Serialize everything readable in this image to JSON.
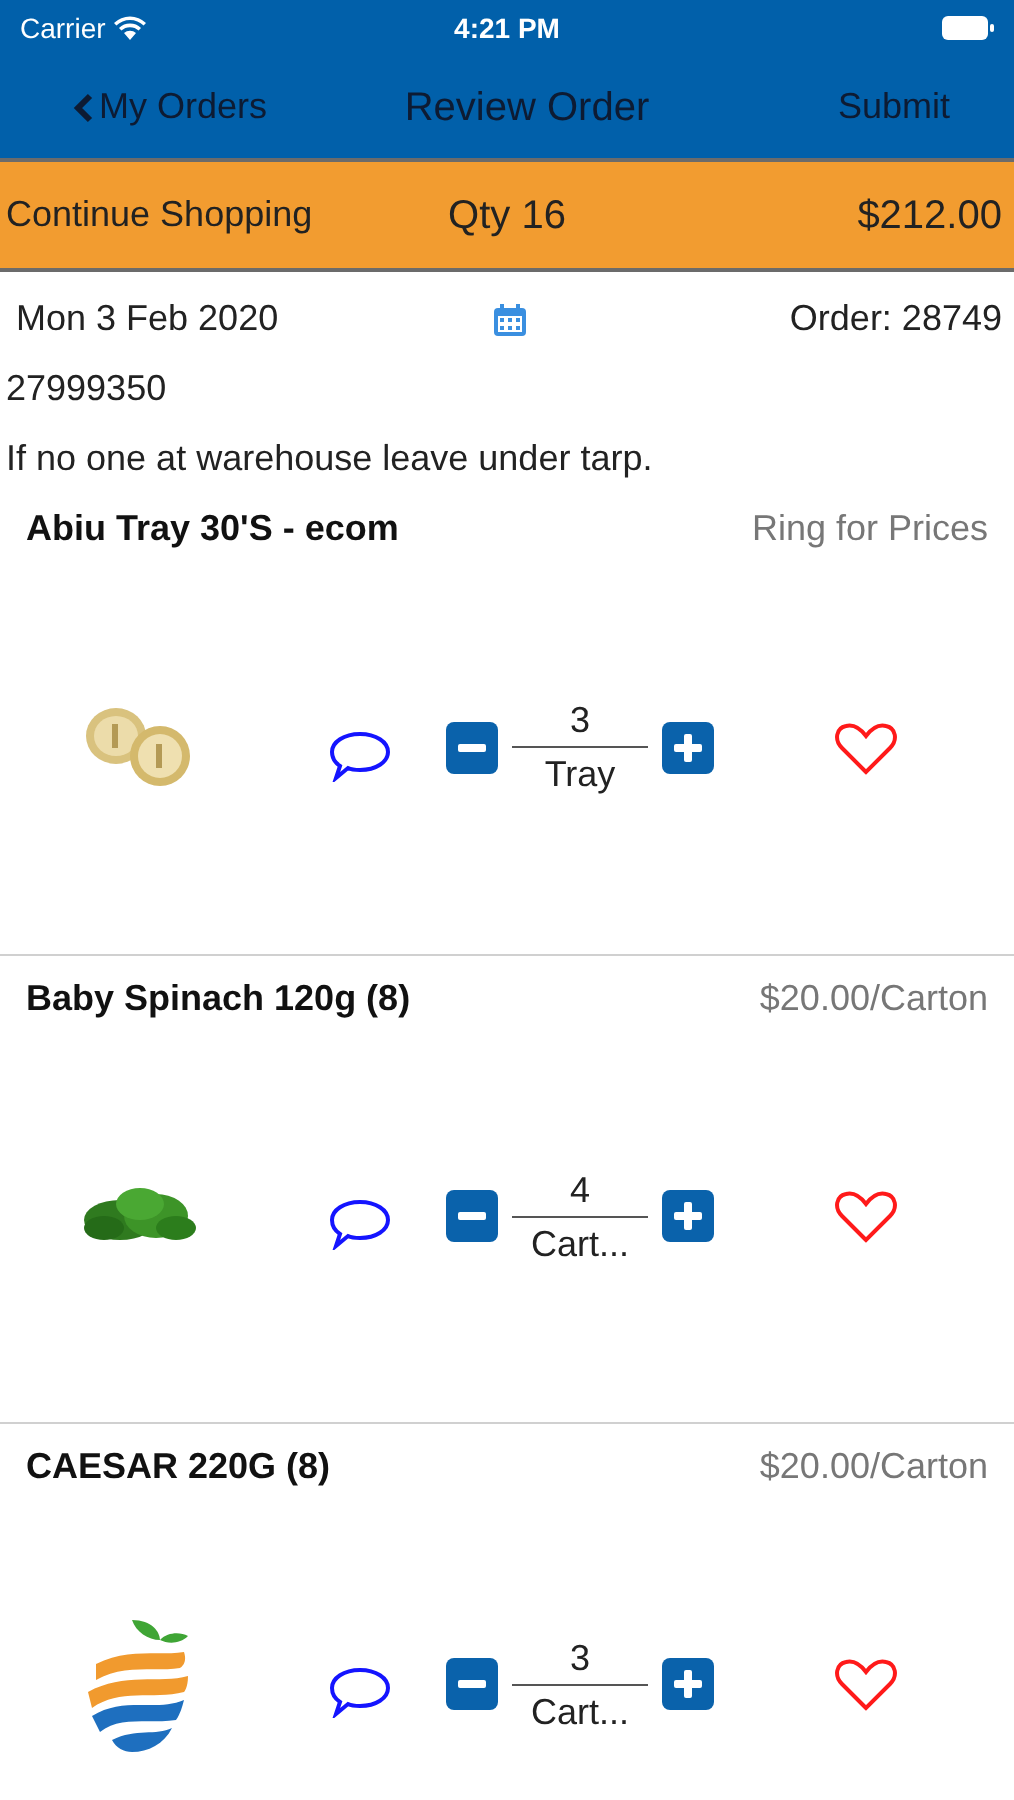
{
  "status_bar": {
    "carrier": "Carrier",
    "time": "4:21 PM"
  },
  "nav": {
    "back": "My Orders",
    "title": "Review Order",
    "action": "Submit"
  },
  "summary": {
    "link": "Continue Shopping",
    "qty": "Qty 16",
    "total": "$212.00"
  },
  "order": {
    "date": "Mon 3 Feb 2020",
    "number": "Order: 28749",
    "account": "27999350",
    "note": "If no one at warehouse leave under tarp."
  },
  "products": [
    {
      "name": "Abiu Tray 30'S - ecom",
      "price": "Ring for Prices",
      "kind": "picture",
      "quantity": "3",
      "unit": "Tray",
      "favorite": false
    },
    {
      "name": "Baby Spinach 120g (8)",
      "price": "$20.00/Carton",
      "kind": "picture",
      "quantity": "4",
      "unit": "Cart...",
      "favorite": false
    },
    {
      "name": "CAESAR 220G (8)",
      "price": "$20.00/Carton",
      "kind": "logo",
      "quantity": "3",
      "unit": "Cart...",
      "favorite": false
    }
  ]
}
